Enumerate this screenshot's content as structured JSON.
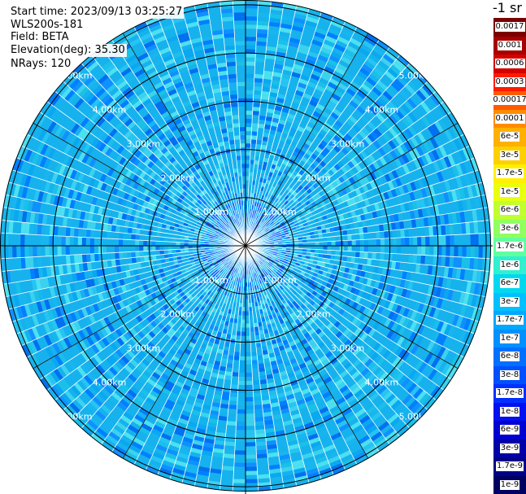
{
  "info": {
    "start_time": "Start time: 2023/09/13 03:25:27",
    "instrument": "WLS200s-181",
    "field": "Field: BETA",
    "elevation": "Elevation(deg): 35.30",
    "nrays": "NRays: 120"
  },
  "colorbar": {
    "title": "-1 sr",
    "labels": [
      "0.0017",
      "0.001",
      "0.0006",
      "0.0003",
      "0.00017",
      "0.0001",
      "6e-5",
      "3e-5",
      "1.7e-5",
      "1e-5",
      "6e-6",
      "3e-6",
      "1.7e-6",
      "1e-6",
      "6e-7",
      "3e-7",
      "1.7e-7",
      "1e-7",
      "6e-8",
      "3e-8",
      "1.7e-8",
      "1e-8",
      "6e-9",
      "3e-9",
      "1.7e-9",
      "1e-9"
    ],
    "colors": [
      "#7a0000",
      "#a80000",
      "#d40000",
      "#ff1a00",
      "#ff5a00",
      "#ff8c00",
      "#ffb000",
      "#ffd000",
      "#fff000",
      "#e8ff10",
      "#c0ff30",
      "#90ff60",
      "#60ffa0",
      "#30f0d0",
      "#00d8f0",
      "#00c0ff",
      "#00a8ff",
      "#0090ff",
      "#0070ff",
      "#0050ff",
      "#0030ff",
      "#0010f0",
      "#0000d0",
      "#0000a8",
      "#000088",
      "#000060"
    ]
  },
  "chart_data": {
    "type": "ppi",
    "field": "BETA",
    "nrays": 120,
    "elevation_deg": 35.3,
    "range_rings_km": [
      1,
      2,
      3,
      4,
      5
    ],
    "ring_labels": [
      "1.00km",
      "2.00km",
      "3.00km",
      "4.00km",
      "5.00km"
    ],
    "max_range_km": 5.1
  }
}
